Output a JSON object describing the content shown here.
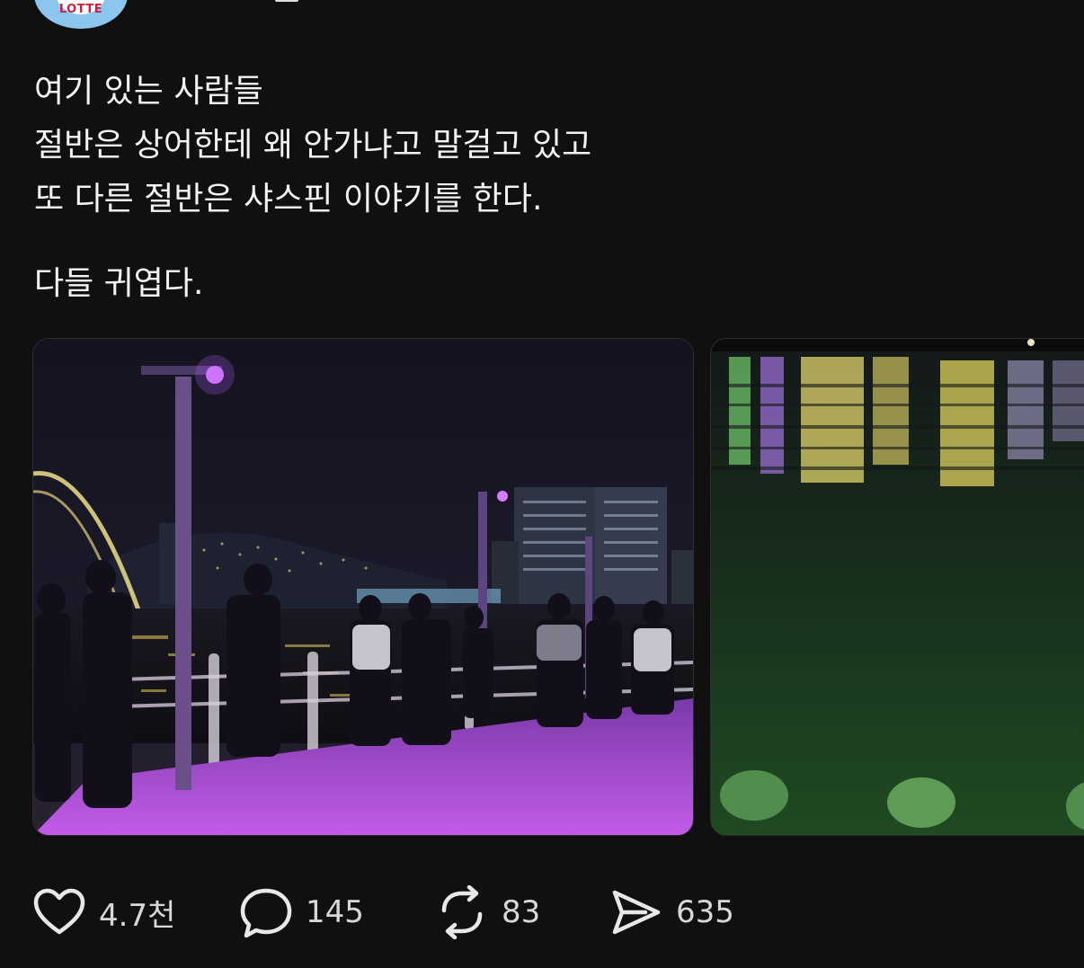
{
  "author": {
    "avatar_logo": "LOTTE"
  },
  "post": {
    "lines": [
      "여기 있는 사람들",
      "절반은 상어한테 왜 안가냐고 말걸고 있고",
      "또 다른 절반은 샤스핀 이야기를 한다.",
      "다들 귀엽다."
    ]
  },
  "media": [
    {
      "icon": "night-waterfront-photo"
    },
    {
      "icon": "water-reflection-photo"
    }
  ],
  "actions": {
    "like": {
      "icon": "heart-icon",
      "count": "4.7천"
    },
    "reply": {
      "icon": "speech-bubble-icon",
      "count": "145"
    },
    "repost": {
      "icon": "repost-icon",
      "count": "83"
    },
    "share": {
      "icon": "send-icon",
      "count": "635"
    }
  },
  "colors": {
    "background": "#101010",
    "text": "#f3f3f3",
    "accent_purple": "#a04cff",
    "accent_green": "#1f5a22"
  }
}
